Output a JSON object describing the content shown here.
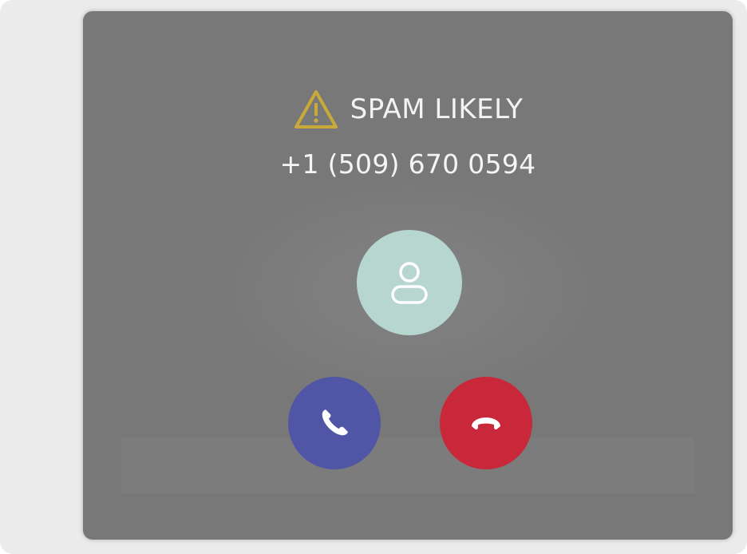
{
  "call": {
    "warning_label": "SPAM LIKELY",
    "phone_number": "+1 (509) 670 0594"
  },
  "icons": {
    "warning": "warning-triangle-icon",
    "avatar": "person-icon",
    "answer": "phone-icon",
    "decline": "phone-hangup-icon"
  },
  "colors": {
    "panel_background": "#777877",
    "warning_icon": "#c9a93a",
    "avatar_background": "#b7d6cf",
    "answer_button": "#5055a6",
    "decline_button": "#c9283a"
  }
}
